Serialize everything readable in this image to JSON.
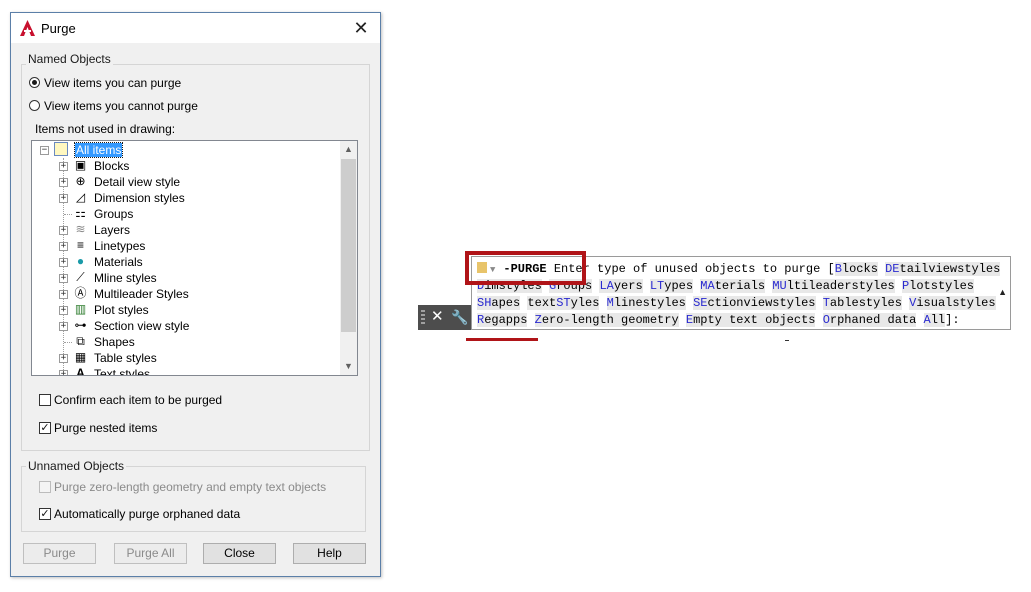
{
  "dialog": {
    "title": "Purge",
    "named_objects": {
      "label": "Named Objects",
      "radio_can_purge": "View items you can purge",
      "radio_cannot_purge": "View items you cannot purge",
      "selected_radio": "View items you can purge",
      "list_label": "Items not used in drawing:",
      "tree_items": [
        {
          "label": "All items",
          "icon": "drawing-icon",
          "selected": true
        },
        {
          "label": "Blocks",
          "icon": "blocks-icon"
        },
        {
          "label": "Detail view style",
          "icon": "detail-view-icon"
        },
        {
          "label": "Dimension styles",
          "icon": "dimension-icon"
        },
        {
          "label": "Groups",
          "icon": "groups-icon"
        },
        {
          "label": "Layers",
          "icon": "layers-icon"
        },
        {
          "label": "Linetypes",
          "icon": "linetypes-icon"
        },
        {
          "label": "Materials",
          "icon": "materials-icon"
        },
        {
          "label": "Mline styles",
          "icon": "mline-icon"
        },
        {
          "label": "Multileader Styles",
          "icon": "multileader-icon"
        },
        {
          "label": "Plot styles",
          "icon": "plot-styles-icon"
        },
        {
          "label": "Section view style",
          "icon": "section-view-icon"
        },
        {
          "label": "Shapes",
          "icon": "shapes-icon"
        },
        {
          "label": "Table styles",
          "icon": "table-icon"
        },
        {
          "label": "Text styles",
          "icon": "text-icon"
        }
      ],
      "confirm_each": {
        "label": "Confirm each item to be purged",
        "checked": false
      },
      "purge_nested": {
        "label": "Purge nested items",
        "checked": true
      }
    },
    "unnamed_objects": {
      "label": "Unnamed Objects",
      "purge_zero_length": {
        "label": "Purge zero-length geometry and empty text objects",
        "checked": false,
        "enabled": false
      },
      "auto_purge_orphaned": {
        "label": "Automatically purge orphaned data",
        "checked": true
      }
    },
    "buttons": {
      "purge": "Purge",
      "purge_all": "Purge All",
      "close": "Close",
      "help": "Help"
    }
  },
  "command_line": {
    "command": "-PURGE",
    "prompt": "Enter type of unused objects to purge [",
    "options": [
      {
        "key": "B",
        "rest": "locks"
      },
      {
        "key": "DE",
        "rest": "tailviewstyles"
      },
      {
        "key": "D",
        "rest": "imstyles"
      },
      {
        "key": "G",
        "rest": "roups"
      },
      {
        "key": "LA",
        "rest": "yers"
      },
      {
        "key": "LT",
        "rest": "ypes"
      },
      {
        "key": "MA",
        "rest": "terials"
      },
      {
        "key": "MU",
        "rest": "ltileaderstyles"
      },
      {
        "key": "P",
        "rest": "lotstyles"
      },
      {
        "key": "SH",
        "rest": "apes"
      },
      {
        "pre": "text",
        "key": "ST",
        "rest": "yles"
      },
      {
        "key": "M",
        "rest": "linestyles"
      },
      {
        "key": "SE",
        "rest": "ctionviewstyles"
      },
      {
        "key": "T",
        "rest": "ablestyles"
      },
      {
        "key": "V",
        "rest": "isualstyles"
      },
      {
        "key": "R",
        "rest": "egapps"
      },
      {
        "key": "Z",
        "rest": "ero-length geometry"
      },
      {
        "key": "E",
        "rest": "mpty text objects"
      },
      {
        "key": "O",
        "rest": "rphaned data"
      },
      {
        "key": "A",
        "rest": "ll"
      }
    ],
    "close_symbol": "✕",
    "wrench_symbol": "🔧",
    "end": "]:"
  },
  "colors": {
    "highlight_red": "#b01418",
    "option_blue": "#2a2ad0",
    "selection_blue": "#3399ff"
  }
}
